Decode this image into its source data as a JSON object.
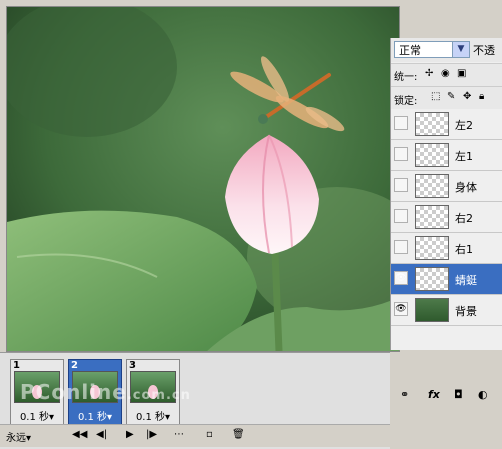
{
  "blend": {
    "mode": "正常",
    "opacity_label": "不透"
  },
  "unify": {
    "label": "统一:"
  },
  "lock": {
    "label": "锁定:"
  },
  "layers": [
    {
      "name": "左2",
      "visible": false,
      "selected": false,
      "thumb": "transparent"
    },
    {
      "name": "左1",
      "visible": false,
      "selected": false,
      "thumb": "transparent"
    },
    {
      "name": "身体",
      "visible": false,
      "selected": false,
      "thumb": "transparent"
    },
    {
      "name": "右2",
      "visible": false,
      "selected": false,
      "thumb": "transparent"
    },
    {
      "name": "右1",
      "visible": false,
      "selected": false,
      "thumb": "transparent"
    },
    {
      "name": "蜻蜓",
      "visible": true,
      "selected": true,
      "thumb": "transparent"
    },
    {
      "name": "背景",
      "visible": true,
      "selected": false,
      "thumb": "image"
    }
  ],
  "frames": [
    {
      "num": "1",
      "time": "0.1 秒▾",
      "selected": false
    },
    {
      "num": "2",
      "time": "0.1 秒▾",
      "selected": true
    },
    {
      "num": "3",
      "time": "0.1 秒▾",
      "selected": false
    }
  ],
  "anim_toolbar": {
    "loop": "永远▾"
  },
  "watermark": {
    "main": "PConline",
    "sub": ".com.cn"
  },
  "colors": {
    "selection": "#3a6ec1",
    "panel": "#d4d0c8"
  }
}
